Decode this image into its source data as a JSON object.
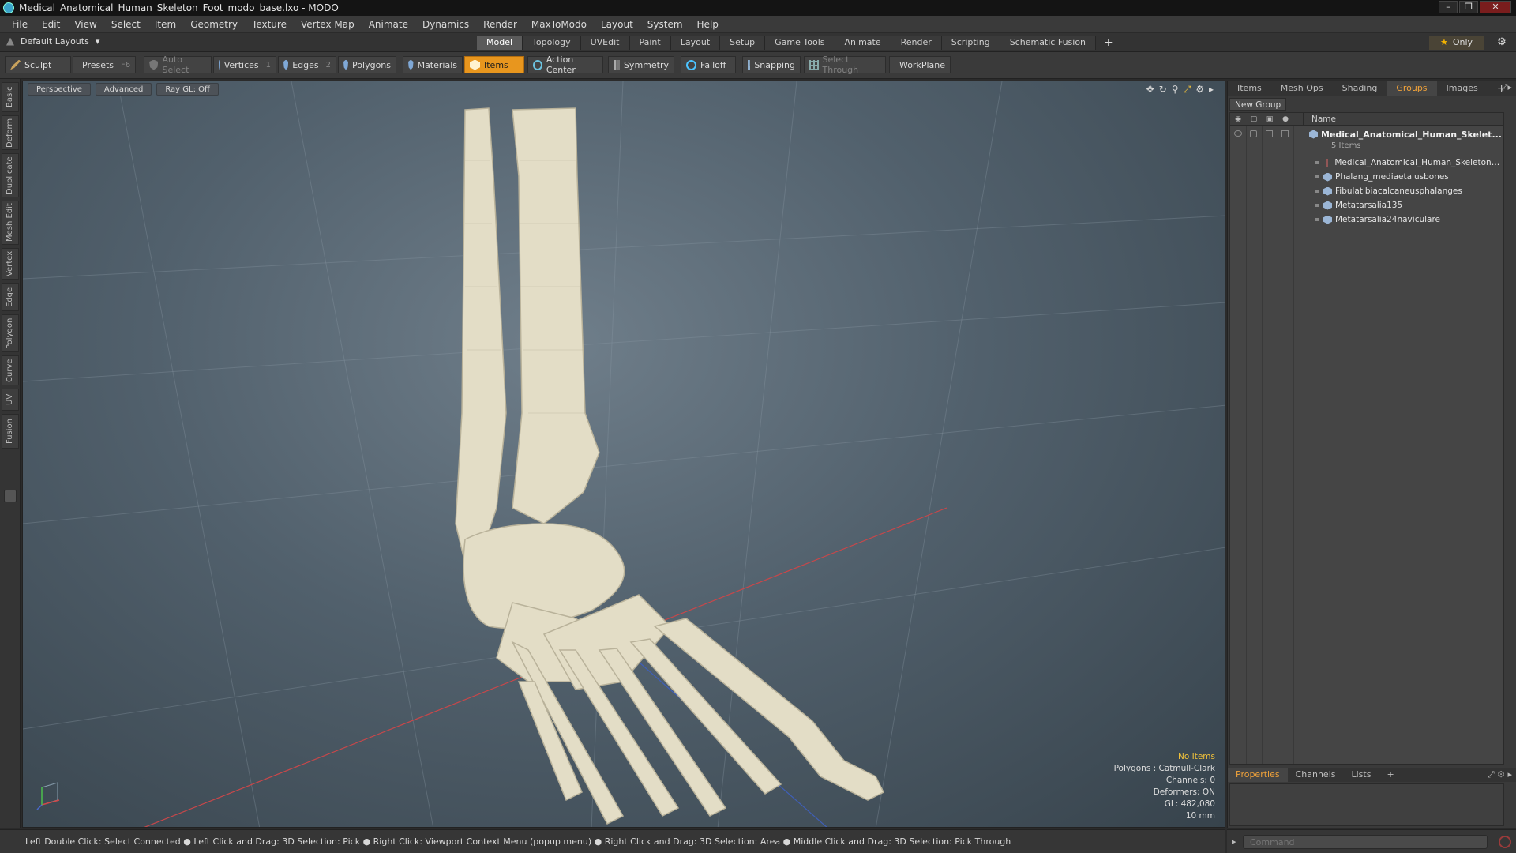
{
  "window": {
    "title": "Medical_Anatomical_Human_Skeleton_Foot_modo_base.lxo - MODO"
  },
  "menu": [
    "File",
    "Edit",
    "View",
    "Select",
    "Item",
    "Geometry",
    "Texture",
    "Vertex Map",
    "Animate",
    "Dynamics",
    "Render",
    "MaxToModo",
    "Layout",
    "System",
    "Help"
  ],
  "layout_selector": "Default Layouts",
  "tabs": [
    "Model",
    "Topology",
    "UVEdit",
    "Paint",
    "Layout",
    "Setup",
    "Game Tools",
    "Animate",
    "Render",
    "Scripting",
    "Schematic Fusion"
  ],
  "tabs_add": "+",
  "only_label": "Only",
  "toolbar": {
    "sculpt": "Sculpt",
    "presets": "Presets",
    "presets_key": "F6",
    "auto_select": "Auto Select",
    "vertices": "Vertices",
    "vertices_key": "1",
    "edges": "Edges",
    "edges_key": "2",
    "polygons": "Polygons",
    "materials": "Materials",
    "items": "Items",
    "action_center": "Action Center",
    "symmetry": "Symmetry",
    "falloff": "Falloff",
    "snapping": "Snapping",
    "select_through": "Select Through",
    "workplane": "WorkPlane"
  },
  "left_tabs": [
    "Basic",
    "Deform",
    "Duplicate",
    "Mesh Edit",
    "Vertex",
    "Edge",
    "Polygon",
    "Curve",
    "UV",
    "Fusion"
  ],
  "viewport": {
    "buttons": [
      "Perspective",
      "Advanced",
      "Ray GL: Off"
    ],
    "info": {
      "selection": "No Items",
      "polygons": "Polygons : Catmull-Clark",
      "channels": "Channels: 0",
      "deformers": "Deformers: ON",
      "gl": "GL: 482,080",
      "scale": "10 mm"
    }
  },
  "right_panel": {
    "tabs": [
      "Items",
      "Mesh Ops",
      "Shading",
      "Groups",
      "Images",
      "+"
    ],
    "active_tab": "Groups",
    "new_group": "New Group",
    "column_name": "Name",
    "group": {
      "name": "Medical_Anatomical_Human_Skelet...",
      "count": "5 Items"
    },
    "items": [
      {
        "name": "Medical_Anatomical_Human_Skeleton_F ...",
        "kind": "locator"
      },
      {
        "name": "Phalang_mediaetalusbones",
        "kind": "mesh"
      },
      {
        "name": "Fibulatibiacalcaneusphalanges",
        "kind": "mesh"
      },
      {
        "name": "Metatarsalia135",
        "kind": "mesh"
      },
      {
        "name": "Metatarsalia24naviculare",
        "kind": "mesh"
      }
    ],
    "bottom_tabs": [
      "Properties",
      "Channels",
      "Lists",
      "+"
    ]
  },
  "statusbar": "Left Double Click: Select Connected ● Left Click and Drag: 3D Selection: Pick ● Right Click: Viewport Context Menu (popup menu) ● Right Click and Drag: 3D Selection: Area ● Middle Click and Drag: 3D Selection: Pick Through",
  "command_placeholder": "Command",
  "colors": {
    "accent": "#e8961e",
    "active_tab_text": "#f2a33a",
    "info_highlight": "#f2c23a"
  }
}
